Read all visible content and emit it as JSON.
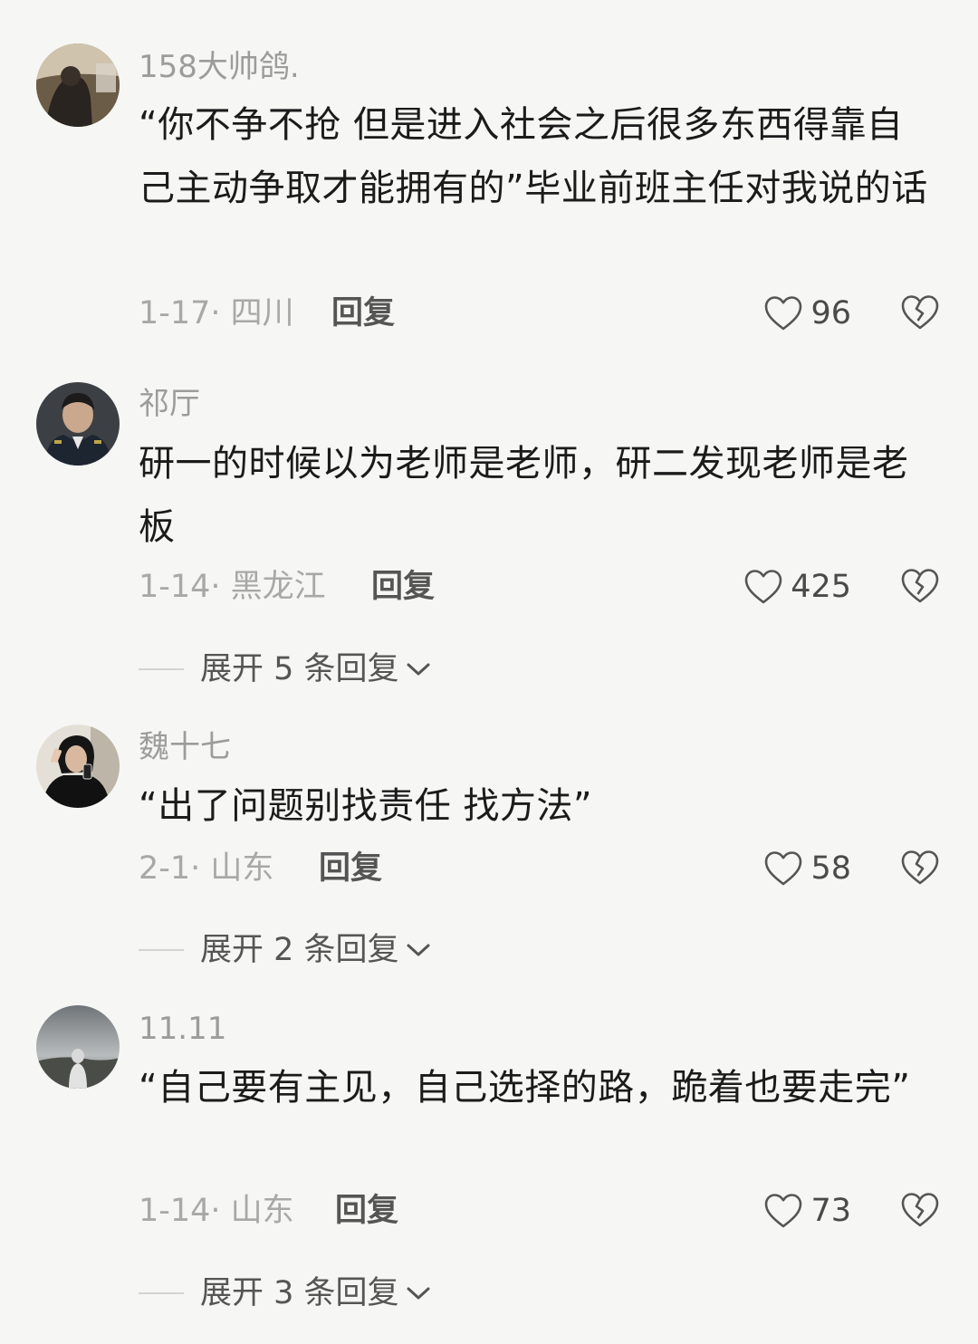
{
  "comments": [
    {
      "username": "158大帅鸽.",
      "text": "“你不争不抢 但是进入社会之后很多东西得靠自己主动争取才能拥有的”毕业前班主任对我说的话",
      "meta": "1-17· 四川",
      "reply_label": "回复",
      "likes": "96",
      "avatar_icon": "avatar-photo"
    },
    {
      "username": "祁厅",
      "text": "研一的时候以为老师是老师，研二发现老师是老板",
      "meta": "1-14· 黑龙江",
      "reply_label": "回复",
      "likes": "425",
      "expand_label": "展开 5 条回复",
      "avatar_icon": "avatar-photo"
    },
    {
      "username": "魏十七",
      "text": "“出了问题别找责任 找方法”",
      "meta": "2-1· 山东",
      "reply_label": "回复",
      "likes": "58",
      "expand_label": "展开 2 条回复",
      "avatar_icon": "avatar-photo"
    },
    {
      "username": "11.11",
      "text": "“自己要有主见，自己选择的路，跪着也要走完”",
      "meta": "1-14· 山东",
      "reply_label": "回复",
      "likes": "73",
      "expand_label": "展开 3 条回复",
      "avatar_icon": "avatar-photo"
    }
  ],
  "icons": {
    "like": "heart-outline-icon",
    "dislike": "broken-heart-icon",
    "expand": "chevron-down-icon"
  },
  "colors": {
    "background": "#f6f6f4",
    "muted": "#a8a8a8",
    "text": "#1b1b1b"
  }
}
